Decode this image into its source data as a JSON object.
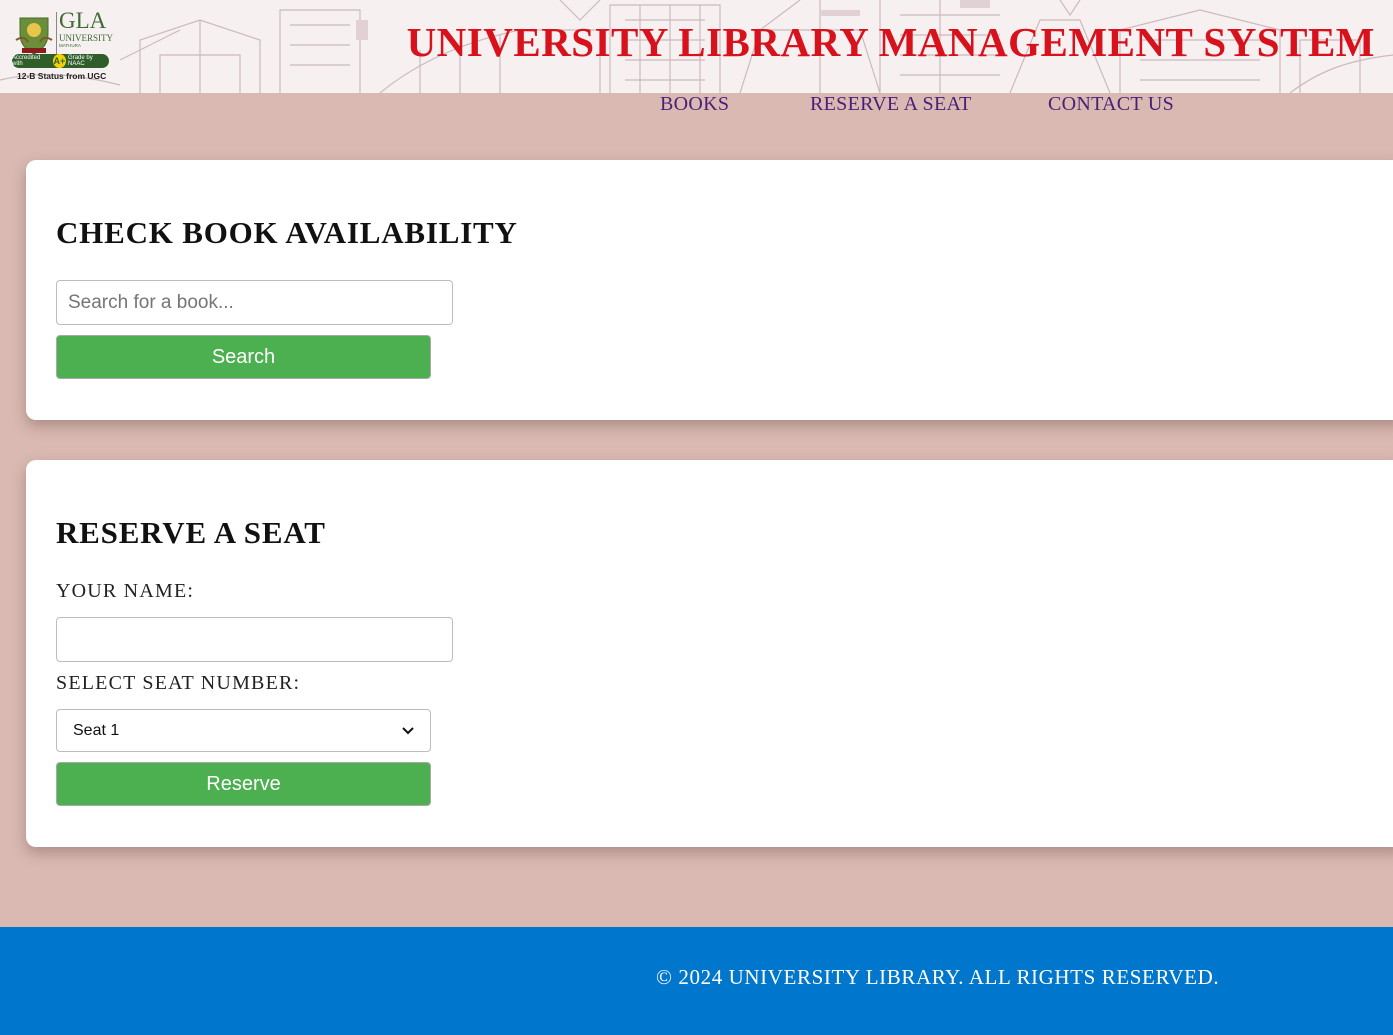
{
  "header": {
    "logo": {
      "name": "GLA",
      "univ": "UNIVERSITY",
      "city": "MATHURA",
      "badge_prefix": "Accredited with",
      "badge_grade": "A+",
      "badge_suffix": "Grade by NAAC",
      "status": "12-B Status from UGC"
    },
    "title": "UNIVERSITY LIBRARY MANAGEMENT SYSTEM"
  },
  "nav": {
    "items": [
      {
        "label": "BOOKS"
      },
      {
        "label": "RESERVE A SEAT"
      },
      {
        "label": "CONTACT US"
      }
    ]
  },
  "book_search": {
    "title": "CHECK BOOK AVAILABILITY",
    "placeholder": "Search for a book...",
    "value": "",
    "button_label": "Search"
  },
  "reserve": {
    "title": "RESERVE A SEAT",
    "name_label": "YOUR NAME:",
    "name_value": "",
    "seat_label": "SELECT SEAT NUMBER:",
    "seat_selected": "Seat 1",
    "button_label": "Reserve"
  },
  "footer": {
    "text": "© 2024 UNIVERSITY LIBRARY. ALL RIGHTS RESERVED."
  },
  "colors": {
    "page_bg": "#d9b9b1",
    "title_red": "#d8121d",
    "nav_purple": "#4a1f7a",
    "button_green": "#4caf50",
    "footer_blue": "#0077cc"
  }
}
